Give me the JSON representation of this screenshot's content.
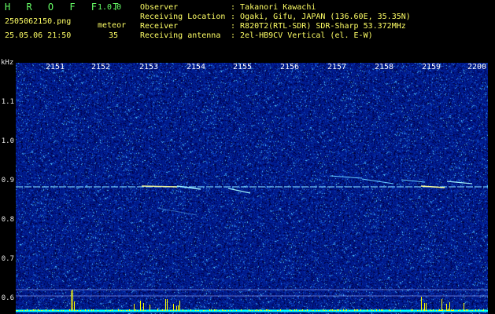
{
  "header": {
    "app_title": "H R O F F T",
    "version": "1.0.0",
    "file_name": "2505062150.png",
    "mode": "meteor",
    "datetime": "25.05.06 21:50",
    "count": "35"
  },
  "info": [
    {
      "key": "Observer",
      "value": ": Takanori Kawachi"
    },
    {
      "key": "Receiving Location",
      "value": ": Ogaki, Gifu, JAPAN (136.60E, 35.35N)"
    },
    {
      "key": "Receiver",
      "value": ": R820T2(RTL-SDR) SDR-Sharp 53.372MHz"
    },
    {
      "key": "Receiving antenna",
      "value": ": 2el-HB9CV Vertical (el. E-W)"
    }
  ],
  "axis": {
    "unit": "kHz",
    "y_ticks": [
      "1.1",
      "1.0",
      "0.9",
      "0.8",
      "0.7",
      "0.6"
    ],
    "time_ticks": [
      "2151",
      "2152",
      "2153",
      "2154",
      "2155",
      "2156",
      "2157",
      "2158",
      "2159",
      "2200"
    ]
  },
  "colors": {
    "background": "#000000",
    "spectrogram": "#001a8c",
    "header_text": "#ffff66",
    "title_text": "#66ff66",
    "echo_trace": "#66ccff",
    "counter_bars": "#ffff00",
    "baseline": "#00ffff"
  }
}
